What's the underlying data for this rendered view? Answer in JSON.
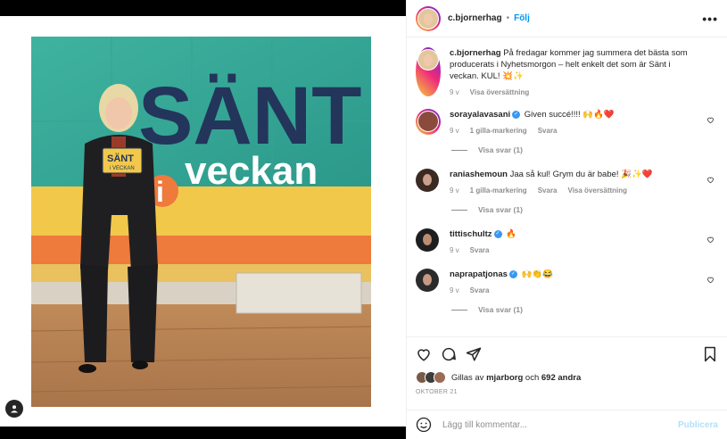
{
  "post": {
    "username": "c.bjornerhag",
    "follow_label": "Följ",
    "more_label": "•••",
    "caption": "På fredagar kommer jag summera det bästa som producerats i Nyhetsmorgon – helt enkelt det som är Sänt i veckan. KUL! 💥✨",
    "caption_age": "9 v",
    "caption_translate": "Visa översättning"
  },
  "photo": {
    "wall_title_1": "SÄNT",
    "wall_title_2": "veckan",
    "wall_i": "i",
    "card_text": "SÄNT",
    "card_sub": "i VECKAN"
  },
  "comments": [
    {
      "user": "sorayalavasani",
      "verified": true,
      "text": "Given succé!!!! 🙌🔥❤️",
      "age": "9 v",
      "likes": "1 gilla-markering",
      "reply": "Svara",
      "translate": "",
      "replies": "Visa svar (1)",
      "avatar_color": "#8a4b3c"
    },
    {
      "user": "raniashemoun",
      "verified": false,
      "text": "Jaa så kul! Grym du är babe! 🎉✨❤️",
      "age": "9 v",
      "likes": "1 gilla-markering",
      "reply": "Svara",
      "translate": "Visa översättning",
      "replies": "Visa svar (1)",
      "avatar_color": "#3a2a22"
    },
    {
      "user": "tittischultz",
      "verified": true,
      "text": "🔥",
      "age": "9 v",
      "likes": "",
      "reply": "Svara",
      "translate": "",
      "replies": "",
      "avatar_color": "#1e1e1e"
    },
    {
      "user": "naprapatjonas",
      "verified": true,
      "text": "🙌👏😂",
      "age": "9 v",
      "likes": "",
      "reply": "Svara",
      "translate": "",
      "replies": "Visa svar (1)",
      "avatar_color": "#2b2b2b"
    }
  ],
  "likes": {
    "prefix": "Gillas av",
    "user": "mjarborg",
    "connector": "och",
    "others": "692 andra"
  },
  "date": "OKTOBER 21",
  "add_comment": {
    "placeholder": "Lägg till kommentar...",
    "post_label": "Publicera"
  },
  "colors": {
    "accent_blue": "#0095f6",
    "muted": "#8e8e8e",
    "wall_teal": "#2ea594",
    "wall_navy": "#23355b"
  }
}
